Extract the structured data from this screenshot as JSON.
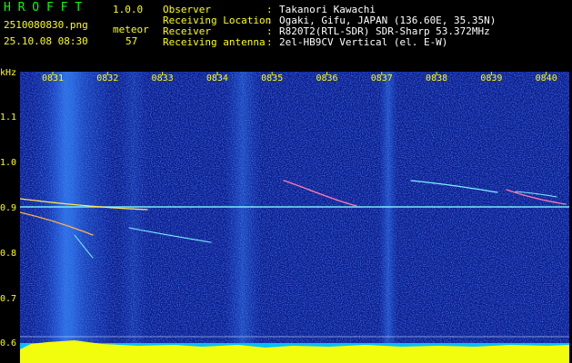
{
  "app": {
    "title": "H R O F F T",
    "version": "1.0.0",
    "filename": "2510080830.png",
    "datetime": "25.10.08 08:30",
    "meteor_label": "meteor",
    "meteor_count": "57"
  },
  "info": {
    "rows": [
      {
        "label": "Observer",
        "sep": ":",
        "value": "Takanori Kawachi"
      },
      {
        "label": "Receiving Location",
        "sep": ":",
        "value": "Ogaki, Gifu, JAPAN (136.60E, 35.35N)"
      },
      {
        "label": "Receiver",
        "sep": ":",
        "value": "R820T2(RTL-SDR) SDR-Sharp 53.372MHz"
      },
      {
        "label": "Receiving antenna",
        "sep": ":",
        "value": "2el-HB9CV Vertical (el. E-W)"
      }
    ]
  },
  "spectrogram": {
    "y_unit": "kHz",
    "y_ticks": [
      "1.1",
      "1.0",
      "0.9",
      "0.8",
      "0.7",
      "0.6"
    ],
    "x_ticks": [
      "0831",
      "0832",
      "0833",
      "0834",
      "0835",
      "0836",
      "0837",
      "0838",
      "0839",
      "0840"
    ],
    "colors": {
      "background": "#0a1a8c",
      "noise": "#1f4bd8",
      "trace": "#7ff0ff",
      "peak": "#ffff00",
      "baseline": "#00d8ff",
      "text": "#ffff00"
    }
  }
}
